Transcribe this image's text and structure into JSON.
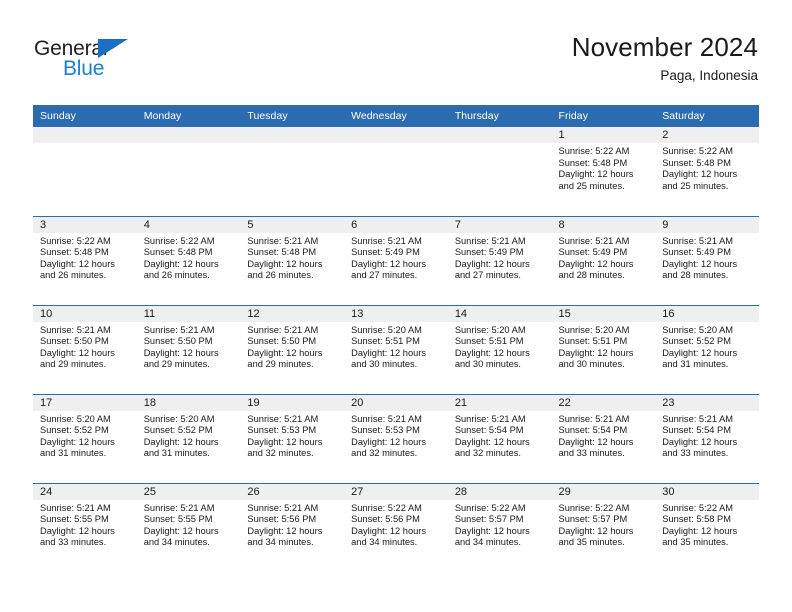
{
  "brand": {
    "word_one": "General",
    "word_two": "Blue",
    "triangle_color": "#1b6fc2",
    "text_color": "#231f20",
    "blue_text_color": "#1b7fd4"
  },
  "header": {
    "title": "November 2024",
    "subtitle": "Paga, Indonesia"
  },
  "theme": {
    "header_blue": "#2b6cb0",
    "daynum_gray": "#efefef",
    "text": "#1a1a1a"
  },
  "weekday_headers": [
    "Sunday",
    "Monday",
    "Tuesday",
    "Wednesday",
    "Thursday",
    "Friday",
    "Saturday"
  ],
  "labels": {
    "sunrise_prefix": "Sunrise:",
    "sunset_prefix": "Sunset:",
    "daylight_prefix": "Daylight:"
  },
  "weeks": [
    [
      {
        "day": "",
        "empty": true,
        "sunrise": "",
        "sunset": "",
        "daylight_line1": "",
        "daylight_line2": ""
      },
      {
        "day": "",
        "empty": true,
        "sunrise": "",
        "sunset": "",
        "daylight_line1": "",
        "daylight_line2": ""
      },
      {
        "day": "",
        "empty": true,
        "sunrise": "",
        "sunset": "",
        "daylight_line1": "",
        "daylight_line2": ""
      },
      {
        "day": "",
        "empty": true,
        "sunrise": "",
        "sunset": "",
        "daylight_line1": "",
        "daylight_line2": ""
      },
      {
        "day": "",
        "empty": true,
        "sunrise": "",
        "sunset": "",
        "daylight_line1": "",
        "daylight_line2": ""
      },
      {
        "day": "1",
        "empty": false,
        "sunrise": "Sunrise: 5:22 AM",
        "sunset": "Sunset: 5:48 PM",
        "daylight_line1": "Daylight: 12 hours",
        "daylight_line2": "and 25 minutes."
      },
      {
        "day": "2",
        "empty": false,
        "sunrise": "Sunrise: 5:22 AM",
        "sunset": "Sunset: 5:48 PM",
        "daylight_line1": "Daylight: 12 hours",
        "daylight_line2": "and 25 minutes."
      }
    ],
    [
      {
        "day": "3",
        "empty": false,
        "sunrise": "Sunrise: 5:22 AM",
        "sunset": "Sunset: 5:48 PM",
        "daylight_line1": "Daylight: 12 hours",
        "daylight_line2": "and 26 minutes."
      },
      {
        "day": "4",
        "empty": false,
        "sunrise": "Sunrise: 5:22 AM",
        "sunset": "Sunset: 5:48 PM",
        "daylight_line1": "Daylight: 12 hours",
        "daylight_line2": "and 26 minutes."
      },
      {
        "day": "5",
        "empty": false,
        "sunrise": "Sunrise: 5:21 AM",
        "sunset": "Sunset: 5:48 PM",
        "daylight_line1": "Daylight: 12 hours",
        "daylight_line2": "and 26 minutes."
      },
      {
        "day": "6",
        "empty": false,
        "sunrise": "Sunrise: 5:21 AM",
        "sunset": "Sunset: 5:49 PM",
        "daylight_line1": "Daylight: 12 hours",
        "daylight_line2": "and 27 minutes."
      },
      {
        "day": "7",
        "empty": false,
        "sunrise": "Sunrise: 5:21 AM",
        "sunset": "Sunset: 5:49 PM",
        "daylight_line1": "Daylight: 12 hours",
        "daylight_line2": "and 27 minutes."
      },
      {
        "day": "8",
        "empty": false,
        "sunrise": "Sunrise: 5:21 AM",
        "sunset": "Sunset: 5:49 PM",
        "daylight_line1": "Daylight: 12 hours",
        "daylight_line2": "and 28 minutes."
      },
      {
        "day": "9",
        "empty": false,
        "sunrise": "Sunrise: 5:21 AM",
        "sunset": "Sunset: 5:49 PM",
        "daylight_line1": "Daylight: 12 hours",
        "daylight_line2": "and 28 minutes."
      }
    ],
    [
      {
        "day": "10",
        "empty": false,
        "sunrise": "Sunrise: 5:21 AM",
        "sunset": "Sunset: 5:50 PM",
        "daylight_line1": "Daylight: 12 hours",
        "daylight_line2": "and 29 minutes."
      },
      {
        "day": "11",
        "empty": false,
        "sunrise": "Sunrise: 5:21 AM",
        "sunset": "Sunset: 5:50 PM",
        "daylight_line1": "Daylight: 12 hours",
        "daylight_line2": "and 29 minutes."
      },
      {
        "day": "12",
        "empty": false,
        "sunrise": "Sunrise: 5:21 AM",
        "sunset": "Sunset: 5:50 PM",
        "daylight_line1": "Daylight: 12 hours",
        "daylight_line2": "and 29 minutes."
      },
      {
        "day": "13",
        "empty": false,
        "sunrise": "Sunrise: 5:20 AM",
        "sunset": "Sunset: 5:51 PM",
        "daylight_line1": "Daylight: 12 hours",
        "daylight_line2": "and 30 minutes."
      },
      {
        "day": "14",
        "empty": false,
        "sunrise": "Sunrise: 5:20 AM",
        "sunset": "Sunset: 5:51 PM",
        "daylight_line1": "Daylight: 12 hours",
        "daylight_line2": "and 30 minutes."
      },
      {
        "day": "15",
        "empty": false,
        "sunrise": "Sunrise: 5:20 AM",
        "sunset": "Sunset: 5:51 PM",
        "daylight_line1": "Daylight: 12 hours",
        "daylight_line2": "and 30 minutes."
      },
      {
        "day": "16",
        "empty": false,
        "sunrise": "Sunrise: 5:20 AM",
        "sunset": "Sunset: 5:52 PM",
        "daylight_line1": "Daylight: 12 hours",
        "daylight_line2": "and 31 minutes."
      }
    ],
    [
      {
        "day": "17",
        "empty": false,
        "sunrise": "Sunrise: 5:20 AM",
        "sunset": "Sunset: 5:52 PM",
        "daylight_line1": "Daylight: 12 hours",
        "daylight_line2": "and 31 minutes."
      },
      {
        "day": "18",
        "empty": false,
        "sunrise": "Sunrise: 5:20 AM",
        "sunset": "Sunset: 5:52 PM",
        "daylight_line1": "Daylight: 12 hours",
        "daylight_line2": "and 31 minutes."
      },
      {
        "day": "19",
        "empty": false,
        "sunrise": "Sunrise: 5:21 AM",
        "sunset": "Sunset: 5:53 PM",
        "daylight_line1": "Daylight: 12 hours",
        "daylight_line2": "and 32 minutes."
      },
      {
        "day": "20",
        "empty": false,
        "sunrise": "Sunrise: 5:21 AM",
        "sunset": "Sunset: 5:53 PM",
        "daylight_line1": "Daylight: 12 hours",
        "daylight_line2": "and 32 minutes."
      },
      {
        "day": "21",
        "empty": false,
        "sunrise": "Sunrise: 5:21 AM",
        "sunset": "Sunset: 5:54 PM",
        "daylight_line1": "Daylight: 12 hours",
        "daylight_line2": "and 32 minutes."
      },
      {
        "day": "22",
        "empty": false,
        "sunrise": "Sunrise: 5:21 AM",
        "sunset": "Sunset: 5:54 PM",
        "daylight_line1": "Daylight: 12 hours",
        "daylight_line2": "and 33 minutes."
      },
      {
        "day": "23",
        "empty": false,
        "sunrise": "Sunrise: 5:21 AM",
        "sunset": "Sunset: 5:54 PM",
        "daylight_line1": "Daylight: 12 hours",
        "daylight_line2": "and 33 minutes."
      }
    ],
    [
      {
        "day": "24",
        "empty": false,
        "sunrise": "Sunrise: 5:21 AM",
        "sunset": "Sunset: 5:55 PM",
        "daylight_line1": "Daylight: 12 hours",
        "daylight_line2": "and 33 minutes."
      },
      {
        "day": "25",
        "empty": false,
        "sunrise": "Sunrise: 5:21 AM",
        "sunset": "Sunset: 5:55 PM",
        "daylight_line1": "Daylight: 12 hours",
        "daylight_line2": "and 34 minutes."
      },
      {
        "day": "26",
        "empty": false,
        "sunrise": "Sunrise: 5:21 AM",
        "sunset": "Sunset: 5:56 PM",
        "daylight_line1": "Daylight: 12 hours",
        "daylight_line2": "and 34 minutes."
      },
      {
        "day": "27",
        "empty": false,
        "sunrise": "Sunrise: 5:22 AM",
        "sunset": "Sunset: 5:56 PM",
        "daylight_line1": "Daylight: 12 hours",
        "daylight_line2": "and 34 minutes."
      },
      {
        "day": "28",
        "empty": false,
        "sunrise": "Sunrise: 5:22 AM",
        "sunset": "Sunset: 5:57 PM",
        "daylight_line1": "Daylight: 12 hours",
        "daylight_line2": "and 34 minutes."
      },
      {
        "day": "29",
        "empty": false,
        "sunrise": "Sunrise: 5:22 AM",
        "sunset": "Sunset: 5:57 PM",
        "daylight_line1": "Daylight: 12 hours",
        "daylight_line2": "and 35 minutes."
      },
      {
        "day": "30",
        "empty": false,
        "sunrise": "Sunrise: 5:22 AM",
        "sunset": "Sunset: 5:58 PM",
        "daylight_line1": "Daylight: 12 hours",
        "daylight_line2": "and 35 minutes."
      }
    ]
  ]
}
